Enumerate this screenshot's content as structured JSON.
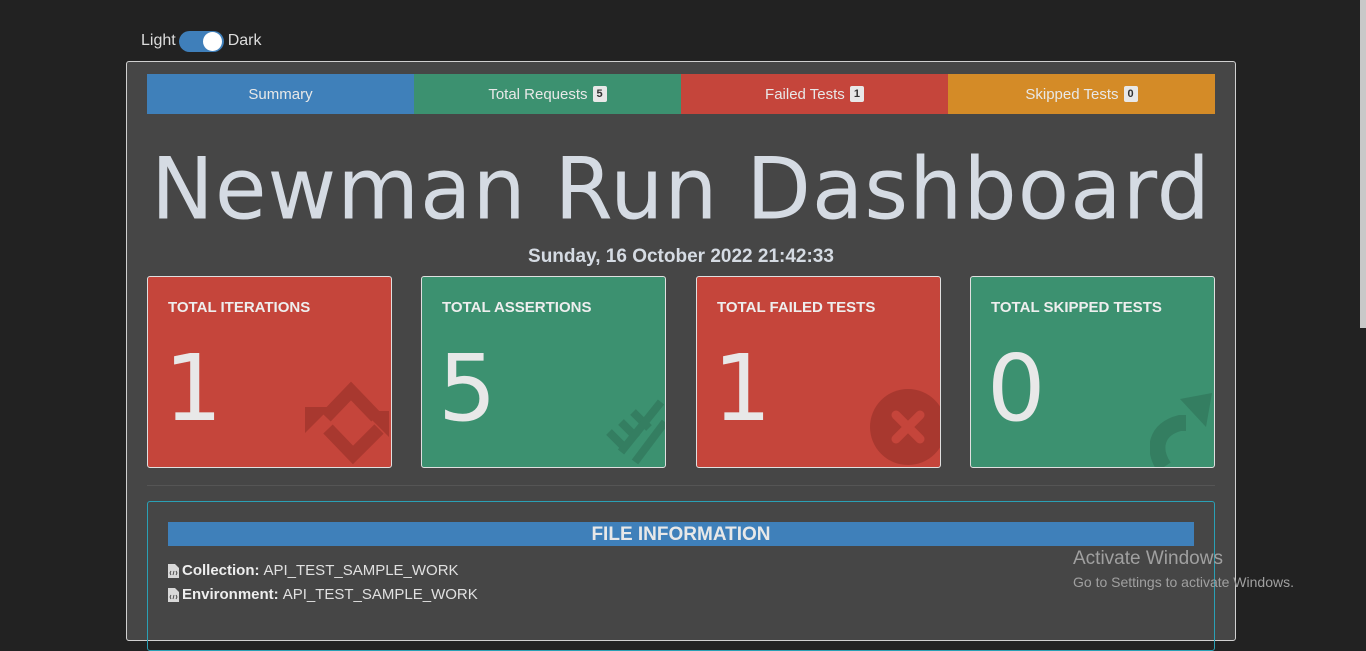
{
  "theme_toggle": {
    "light_label": "Light",
    "dark_label": "Dark",
    "state": "dark"
  },
  "tabs": [
    {
      "label": "Summary",
      "badge": null,
      "color": "#3f80ba"
    },
    {
      "label": "Total Requests",
      "badge": "5",
      "color": "#3c9170"
    },
    {
      "label": "Failed Tests",
      "badge": "1",
      "color": "#c5453b"
    },
    {
      "label": "Skipped Tests",
      "badge": "0",
      "color": "#d48b27"
    }
  ],
  "title": "Newman Run Dashboard",
  "datetime": "Sunday, 16 October 2022 21:42:33",
  "cards": [
    {
      "label": "TOTAL ITERATIONS",
      "value": "1",
      "color": "#c5453b",
      "icon": "sync-icon"
    },
    {
      "label": "TOTAL ASSERTIONS",
      "value": "5",
      "color": "#3c9170",
      "icon": "tasks-icon"
    },
    {
      "label": "TOTAL FAILED TESTS",
      "value": "1",
      "color": "#c5453b",
      "icon": "times-circle-icon"
    },
    {
      "label": "TOTAL SKIPPED TESTS",
      "value": "0",
      "color": "#3c9170",
      "icon": "share-arrow-icon"
    }
  ],
  "file_info": {
    "header": "FILE INFORMATION",
    "collection_label": "Collection:",
    "collection_value": "API_TEST_SAMPLE_WORK",
    "environment_label": "Environment:",
    "environment_value": "API_TEST_SAMPLE_WORK"
  },
  "watermark": {
    "title": "Activate Windows",
    "subtitle": "Go to Settings to activate Windows."
  }
}
